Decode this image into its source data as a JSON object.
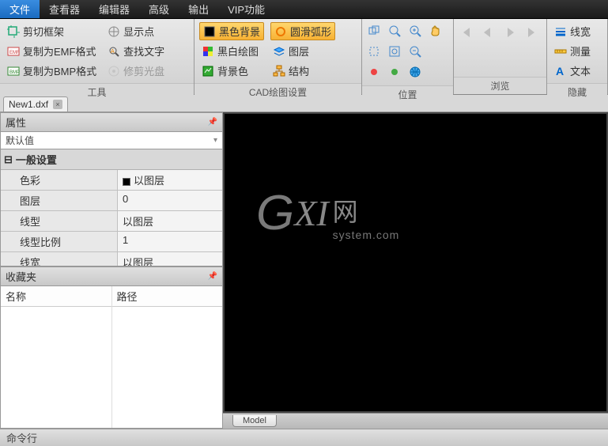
{
  "menu": {
    "items": [
      "文件",
      "查看器",
      "编辑器",
      "高级",
      "输出",
      "VIP功能"
    ],
    "active_index": 0
  },
  "ribbon": {
    "groups": [
      {
        "label": "工具",
        "cols": [
          [
            {
              "icon": "crop",
              "label": "剪切框架"
            },
            {
              "icon": "emf",
              "label": "复制为EMF格式"
            },
            {
              "icon": "bmp",
              "label": "复制为BMP格式"
            }
          ],
          [
            {
              "icon": "points",
              "label": "显示点"
            },
            {
              "icon": "find-text",
              "label": "查找文字"
            },
            {
              "icon": "disc",
              "label": "修剪光盘",
              "dim": true
            }
          ]
        ]
      },
      {
        "label": "CAD绘图设置",
        "cols": [
          [
            {
              "icon": "black-bg",
              "label": "黑色背景",
              "hl": true
            },
            {
              "icon": "bw",
              "label": "黑白绘图"
            },
            {
              "icon": "bgcolor",
              "label": "背景色"
            }
          ],
          [
            {
              "icon": "arc",
              "label": "圆滑弧形",
              "hl": true
            },
            {
              "icon": "layers",
              "label": "图层"
            },
            {
              "icon": "struct",
              "label": "结构"
            }
          ]
        ]
      },
      {
        "label": "位置",
        "icons": [
          "copy-rect",
          "zoom-lens",
          "zoom-in",
          "pan-hand",
          "rect-sel",
          "fit",
          "zoom-out",
          "empty",
          "dot-a",
          "dot-b",
          "globe",
          "empty"
        ]
      },
      {
        "label": "浏览",
        "icons": [
          "nav-first",
          "nav-prev",
          "nav-next",
          "nav-last"
        ]
      },
      {
        "label": "隐藏",
        "cols": [
          [
            {
              "icon": "linew",
              "label": "线宽"
            },
            {
              "icon": "measure",
              "label": "测量"
            },
            {
              "icon": "text-a",
              "label": "文本"
            }
          ]
        ]
      }
    ]
  },
  "doc": {
    "tab_name": "New1.dxf"
  },
  "props": {
    "title": "属性",
    "default_label": "默认值",
    "section": "一般设置",
    "rows": [
      {
        "k": "色彩",
        "v": "以图层",
        "swatch": true
      },
      {
        "k": "图层",
        "v": "0"
      },
      {
        "k": "线型",
        "v": "以图层"
      },
      {
        "k": "线型比例",
        "v": "1"
      },
      {
        "k": "线宽",
        "v": "以图层"
      }
    ]
  },
  "fav": {
    "title": "收藏夹",
    "col1": "名称",
    "col2": "路径"
  },
  "canvas": {
    "wm_cn": "网",
    "wm_en": "system.com"
  },
  "model_tab": "Model",
  "cmd_label": "命令行"
}
